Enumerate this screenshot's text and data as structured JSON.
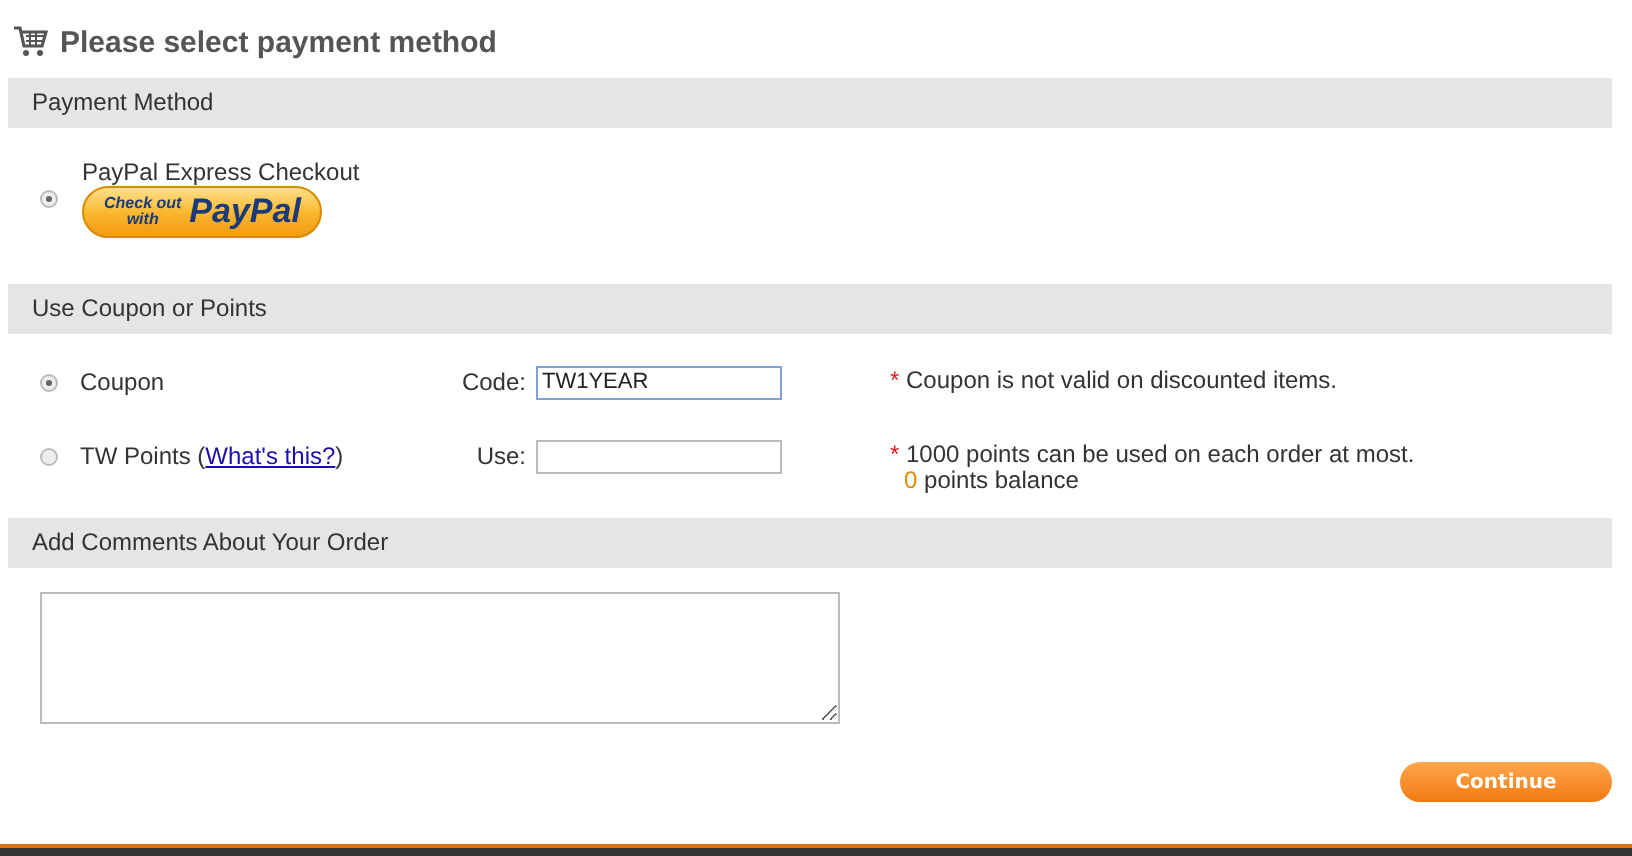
{
  "title": "Please select payment method",
  "payment_section": {
    "heading": "Payment Method",
    "options": [
      {
        "label": "PayPal Express Checkout",
        "selected": true,
        "button": {
          "line_1": "Check out",
          "line_2": "with",
          "brand": "PayPal"
        }
      }
    ]
  },
  "coupon_section": {
    "heading": "Use Coupon or Points",
    "rows": [
      {
        "label": "Coupon",
        "selected": true,
        "field_label": "Code:",
        "value": "TW1YEAR",
        "note_marker": "*",
        "note": "Coupon is not valid on discounted items."
      },
      {
        "label": "TW Points (",
        "link": "What's this?",
        "label_end": ")",
        "selected": false,
        "field_label": "Use:",
        "note_marker": "*",
        "note": "1000 points can be used on each order at most.",
        "balance": "0",
        "balance_label": "points balance"
      }
    ]
  },
  "comments_section": {
    "heading": "Add Comments About Your Order"
  },
  "continue_button": "Continue"
}
